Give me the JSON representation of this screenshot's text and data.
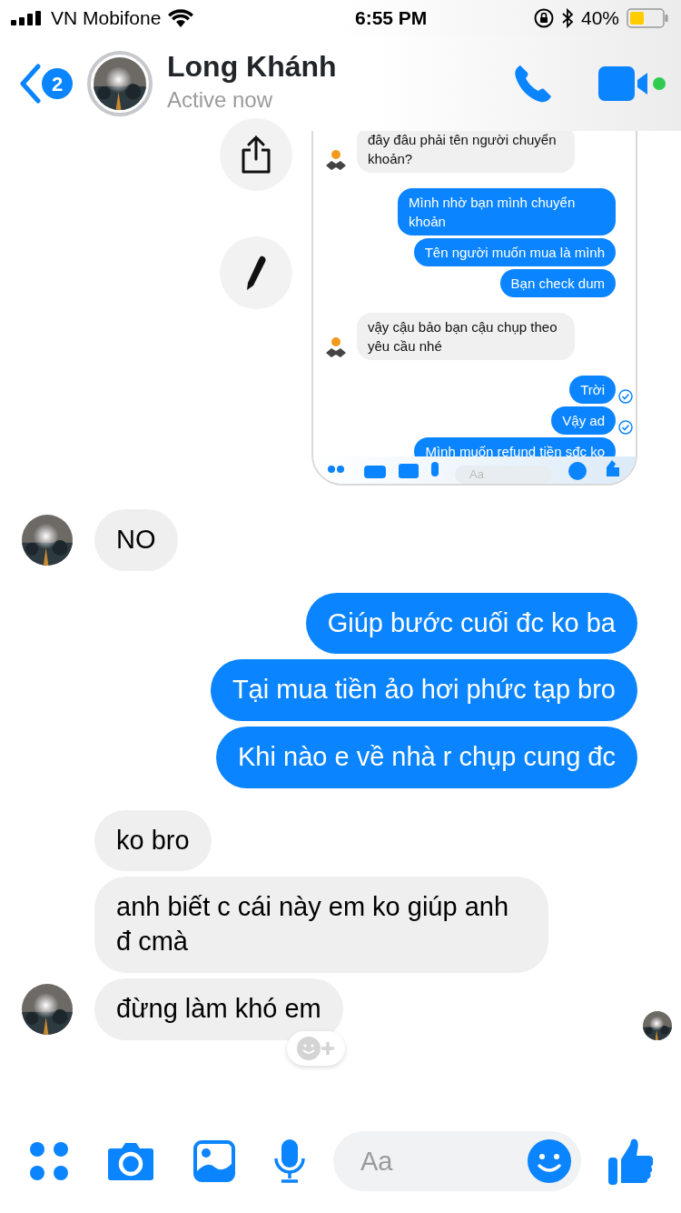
{
  "status_bar": {
    "carrier": "VN Mobifone",
    "time": "6:55 PM",
    "battery": "40%"
  },
  "header": {
    "back_badge": "2",
    "name": "Long Khánh",
    "status": "Active now",
    "online": true
  },
  "shared_screenshot": {
    "messages": [
      {
        "text": "đây đâu phải tên người chuyển khoản?",
        "outgoing": false,
        "avatar": true,
        "read": false
      },
      {
        "text": "Mình nhờ bạn mình chuyển khoản",
        "outgoing": true,
        "read": false
      },
      {
        "text": "Tên người muốn mua là mình",
        "outgoing": true,
        "read": false
      },
      {
        "text": "Bạn check dum",
        "outgoing": true,
        "read": false
      },
      {
        "text": "vậy cậu bảo bạn cậu chụp theo yêu cầu nhé",
        "outgoing": false,
        "avatar": true,
        "read": false
      },
      {
        "text": "Trời",
        "outgoing": true,
        "read": true
      },
      {
        "text": "Vậy ad",
        "outgoing": true,
        "read": true
      },
      {
        "text": "Mình muốn refund tiền sđc ko",
        "outgoing": true,
        "read": false
      }
    ],
    "placeholder": "Aa"
  },
  "messages": [
    {
      "text": "NO",
      "outgoing": false,
      "avatar": true
    },
    {
      "text": "Giúp bước cuối đc ko ba",
      "outgoing": true
    },
    {
      "text": "Tại mua tiền ảo hơi phức tạp bro",
      "outgoing": true
    },
    {
      "text": "Khi nào e về nhà r chụp cung đc",
      "outgoing": true
    },
    {
      "text": "ko bro",
      "outgoing": false,
      "avatar": false
    },
    {
      "text": "anh biết c cái này em ko giúp anh đ cmà",
      "outgoing": false,
      "avatar": false
    },
    {
      "text": "đừng làm khó em",
      "outgoing": false,
      "avatar": true
    }
  ],
  "composer": {
    "placeholder": "Aa"
  }
}
